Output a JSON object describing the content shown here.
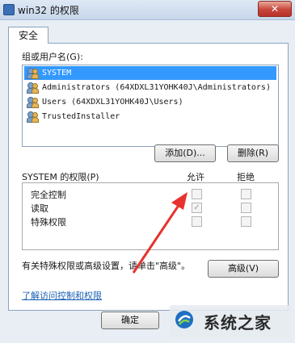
{
  "window": {
    "title": "win32 的权限",
    "close_label": "✕"
  },
  "tabs": [
    {
      "label": "安全"
    }
  ],
  "groups": {
    "label": "组或用户名(G):",
    "items": [
      {
        "label": "SYSTEM",
        "selected": true
      },
      {
        "label": "Administrators (64XDXL31YOHK40J\\Administrators)",
        "selected": false
      },
      {
        "label": "Users (64XDXL31YOHK40J\\Users)",
        "selected": false
      },
      {
        "label": "TrustedInstaller",
        "selected": false
      }
    ],
    "add_label": "添加(D)...",
    "remove_label": "删除(R)"
  },
  "permissions": {
    "title": "SYSTEM 的权限(P)",
    "allow_header": "允许",
    "deny_header": "拒绝",
    "rows": [
      {
        "label": "完全控制",
        "allow": false,
        "deny": false
      },
      {
        "label": "读取",
        "allow": true,
        "deny": false
      },
      {
        "label": "特殊权限",
        "allow": false,
        "deny": false
      }
    ]
  },
  "advanced": {
    "text": "有关特殊权限或高级设置，请单击\"高级\"。",
    "button_label": "高级(V)"
  },
  "link": {
    "text": "了解访问控制和权限"
  },
  "footer": {
    "ok_label": "确定"
  },
  "watermark": {
    "text": "系统之家"
  },
  "colors": {
    "selection": "#3399ff",
    "arrow": "#e8322d",
    "link": "#1a5fb4"
  }
}
